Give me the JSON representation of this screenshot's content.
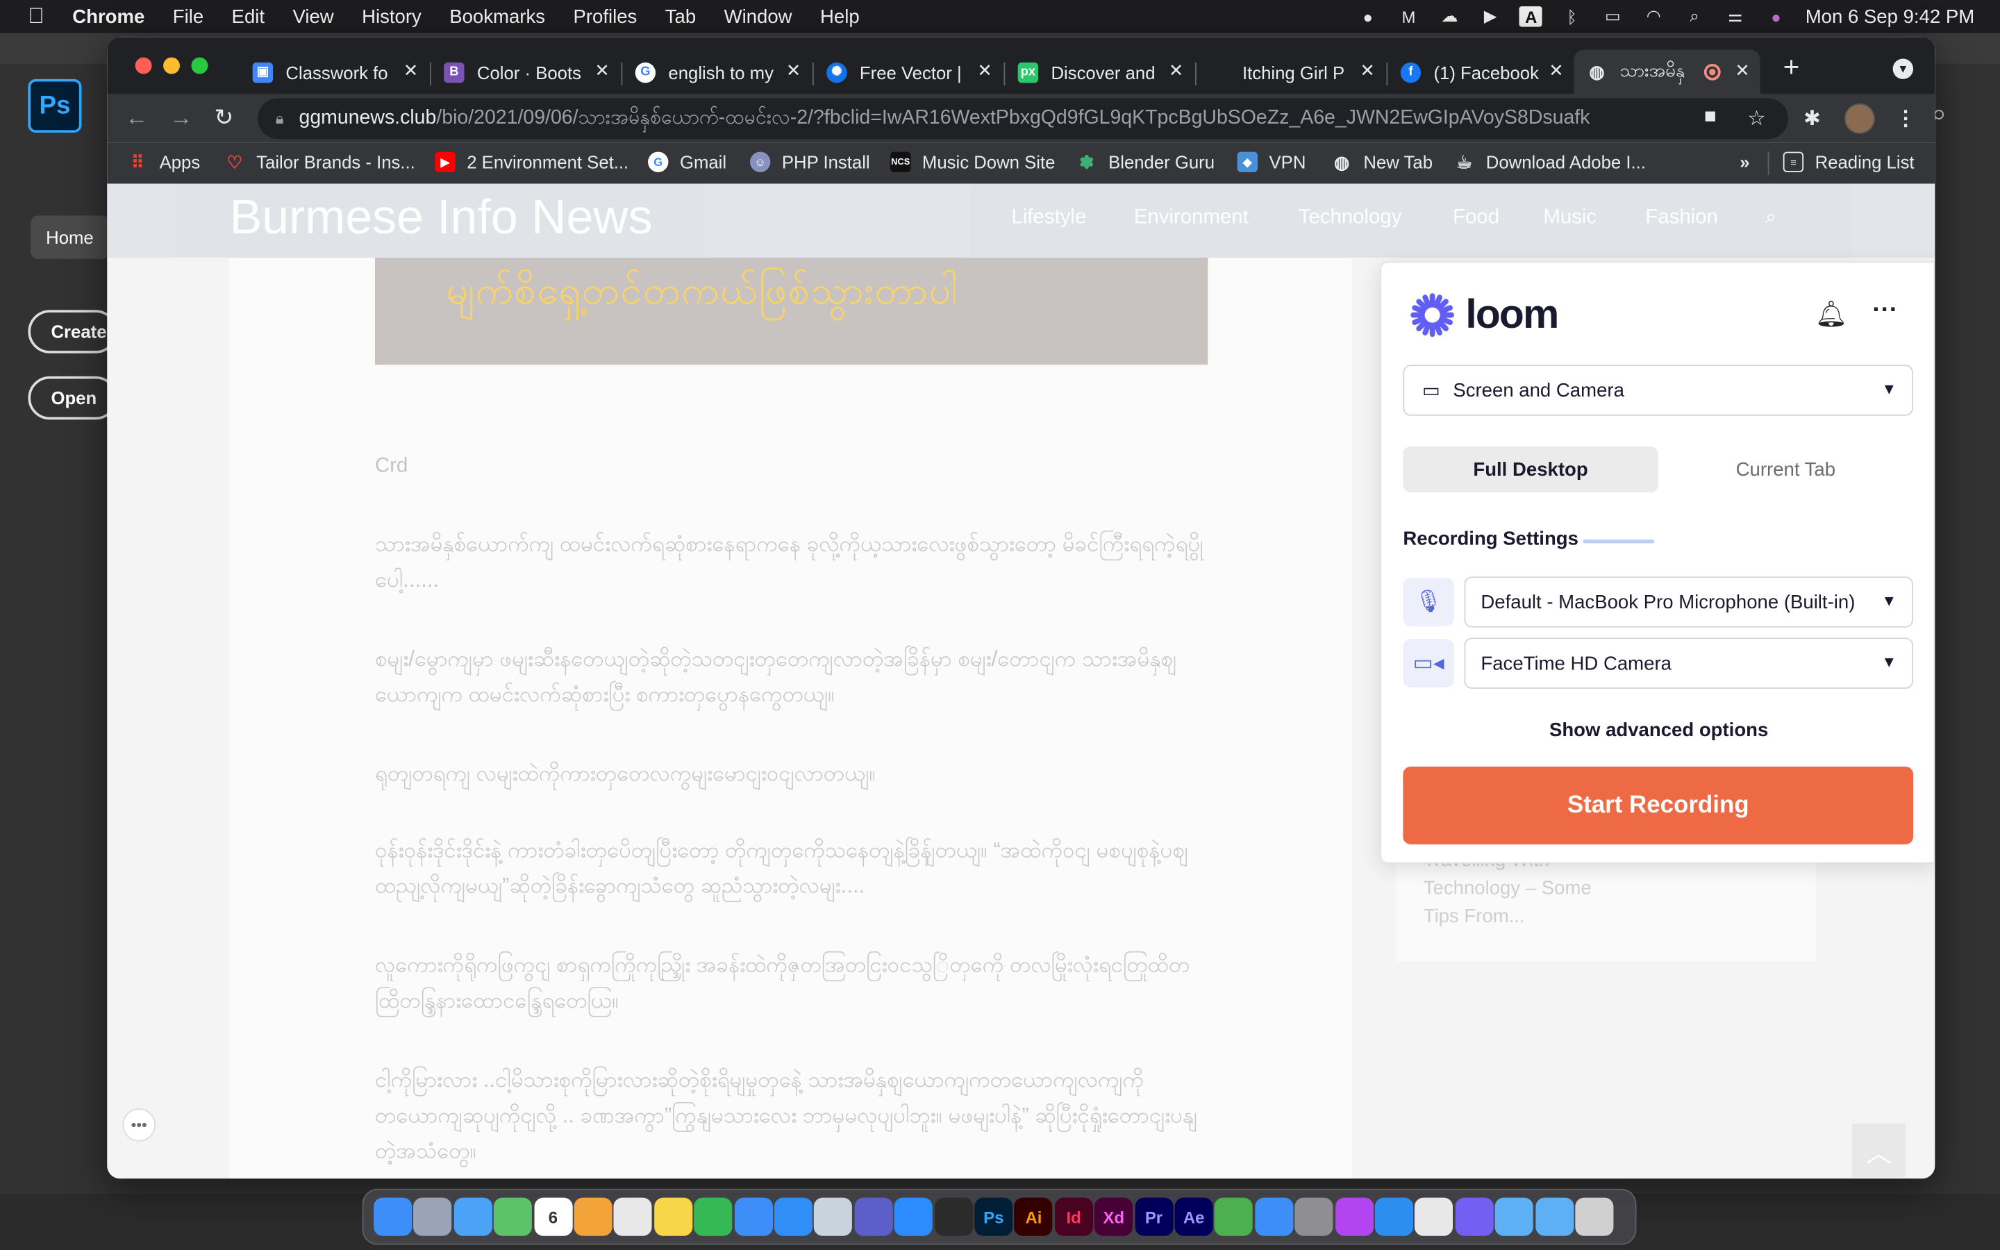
{
  "menubar": {
    "app": "Chrome",
    "menus": [
      "File",
      "Edit",
      "View",
      "History",
      "Bookmarks",
      "Profiles",
      "Tab",
      "Window",
      "Help"
    ],
    "datetime": "Mon 6 Sep  9:42 PM"
  },
  "photoshop": {
    "logo": "Ps",
    "home": "Home",
    "create": "Create",
    "open": "Open"
  },
  "tabs": [
    {
      "title": "Classwork fo",
      "icon": "classroom-icon",
      "color": "#4285f4"
    },
    {
      "title": "Color · Boots",
      "icon": "bootstrap-icon",
      "color": "#7952b3"
    },
    {
      "title": "english to my",
      "icon": "google-icon",
      "color": "#ffffff"
    },
    {
      "title": "Free Vector |",
      "icon": "freepik-icon",
      "color": "#1273eb"
    },
    {
      "title": "Discover and",
      "icon": "pixabay-icon",
      "color": "#2ec66d"
    },
    {
      "title": "Itching Girl P",
      "icon": "blank-icon",
      "color": "#202124"
    },
    {
      "title": "(1) Facebook",
      "icon": "facebook-icon",
      "color": "#1877f2"
    },
    {
      "title": "သားအမိနှ",
      "icon": "globe-icon",
      "color": "#9aa0a6"
    }
  ],
  "address": {
    "host": "ggmunews.club",
    "path": "/bio/2021/09/06/သားအမိနှစ်ယောက်-ထမင်းလ-2/?fbclid=IwAR16WextPbxgQd9fGL9qKTpcBgUbSOeZz_A6e_JWN2EwGIpAVoyS8Dsuafk"
  },
  "bookmarks": [
    {
      "label": "Apps",
      "icon": "apps-grid-icon",
      "color": "#ea4335"
    },
    {
      "label": "Tailor Brands - Ins...",
      "icon": "tailor-brands-icon",
      "color": "#e8453c"
    },
    {
      "label": "2 Environment Set...",
      "icon": "youtube-icon",
      "color": "#ff0000"
    },
    {
      "label": "Gmail",
      "icon": "google-icon",
      "color": "#ffffff"
    },
    {
      "label": "PHP Install",
      "icon": "php-install-icon",
      "color": "#8892bf"
    },
    {
      "label": "Music Down Site",
      "icon": "ncs-icon",
      "color": "#111111"
    },
    {
      "label": "Blender Guru",
      "icon": "blender-guru-icon",
      "color": "#3bb273"
    },
    {
      "label": "VPN",
      "icon": "vpn-icon",
      "color": "#4a90d9"
    },
    {
      "label": "New Tab",
      "icon": "globe-icon",
      "color": "#9aa0a6"
    },
    {
      "label": "Download Adobe I...",
      "icon": "adobe-icon",
      "color": "#aaaaaa"
    }
  ],
  "bookmarks_more": "»",
  "reading_list": "Reading List",
  "site": {
    "title": "Burmese Info News",
    "nav": [
      "Lifestyle",
      "Environment",
      "Technology",
      "Food",
      "Music",
      "Fashion"
    ],
    "hero_caption": "မျက်စိရှေ့တင်တကယ်ဖြစ်သွားတာပါ",
    "credit": "Crd",
    "paragraphs": [
      "သားအမိနှစ်ယောက်ကျ ထမင်းလက်ရဆုံစားနေရာကနေ ခုလို့ကိုယ့သားလေးဖွစ်သွားတော့ မိခင်ကြီးရရကဲ့ရပွိုပေါ့......",
      "စမျး/မွောကျမှာ ဖမျးဆီးနတေယျတဲ့ဆိုတဲ့သတငျးတှတေကျလာတဲ့အခြိန်မှာ စမျး/တောငျက သားအမိနှစျယောကျက ထမင်းလက်ဆုံစားပြီး စကားတှပွောနကွေတယျ။",
      "ရုတျတရကျ လမျးထဲကိုကားတှတေလကွမျးမောငျးဝငျလာတယျ။",
      "ဝုန်းဝုန်းဒိုင်းဒိုင်းနဲ့ ကားတံခါးတှပေိတျပြီးတော့ တိုကျတှကေိုသနေတျနဲ့ခြိန်ျတယျ။ “အထဲကိုဝငျ မစပျစုနဲ့ပစျထညျ့လိုကျမယျ”ဆိုတဲ့ခြိန်းခွောကျသံတွေ ဆူညံသွားတဲ့လမျး....",
      "လူကေားကိုရိုကဖြကွငျ စာရှကကြိုကုည္ဒြိုး အခန်းထဲကိုဇှတအြတငြးဝငသွြိတှကေို တလမြိုးလုံးရငတြုထိတထြိတန္ဒြနားထောငန္ဒြေရတေယြ။",
      "ငါ့ကိုမြားလား ..ငါ့မိသားစုကိုမြားလားဆိုတဲ့စိုးရိမျမှုတှနေဲ့ သားအမိနှစျယောကျကတယောကျလကျကို တယောကျဆုပျကိုငျလို့ .. ခဏအကွာ”ကြွနျမသားလေး ဘာမှမလုပျပါဘူး။ မဖမျးပါနဲ့” ဆိုပြီးငိုရှုံးတောငျးပနျတဲ့အသံတွေ။"
    ],
    "sidebar_text": "Travelling With Technology – Some Tips From..."
  },
  "loom": {
    "brand": "loom",
    "capture_mode": "Screen and Camera",
    "segments": [
      "Full Desktop",
      "Current Tab"
    ],
    "active_segment": "Full Desktop",
    "settings_label": "Recording Settings",
    "microphone": "Default - MacBook Pro Microphone (Built-in)",
    "camera": "FaceTime HD Camera",
    "advanced": "Show advanced options",
    "start": "Start Recording",
    "accent": "#ed6a45"
  },
  "dock": [
    {
      "name": "finder-icon",
      "color": "#3d8ef7",
      "label": ""
    },
    {
      "name": "launchpad-icon",
      "color": "#9aa4b8",
      "label": ""
    },
    {
      "name": "mail-icon",
      "color": "#4aa3f7",
      "label": ""
    },
    {
      "name": "maps-icon",
      "color": "#5cc36b",
      "label": ""
    },
    {
      "name": "calendar-icon",
      "color": "#ffffff",
      "label": "6"
    },
    {
      "name": "pages-icon",
      "color": "#f2a33a",
      "label": ""
    },
    {
      "name": "textedit-icon",
      "color": "#e8e8e8",
      "label": ""
    },
    {
      "name": "notes-icon",
      "color": "#f7d64a",
      "label": ""
    },
    {
      "name": "numbers-icon",
      "color": "#34b955",
      "label": ""
    },
    {
      "name": "keynote-icon",
      "color": "#3d8ef7",
      "label": ""
    },
    {
      "name": "app-store-icon",
      "color": "#2f8ff7",
      "label": ""
    },
    {
      "name": "preview-icon",
      "color": "#c9d3de",
      "label": ""
    },
    {
      "name": "teams-icon",
      "color": "#5b5fc7",
      "label": ""
    },
    {
      "name": "zoom-icon",
      "color": "#2d8cff",
      "label": ""
    },
    {
      "name": "blender-icon",
      "color": "#2b2b2b",
      "label": ""
    },
    {
      "name": "photoshop-icon",
      "color": "#001e36",
      "label": "Ps"
    },
    {
      "name": "illustrator-icon",
      "color": "#330000",
      "label": "Ai"
    },
    {
      "name": "indesign-icon",
      "color": "#49021f",
      "label": "Id"
    },
    {
      "name": "xd-icon",
      "color": "#470137",
      "label": "Xd"
    },
    {
      "name": "premiere-icon",
      "color": "#00005b",
      "label": "Pr"
    },
    {
      "name": "after-effects-icon",
      "color": "#00005b",
      "label": "Ae"
    },
    {
      "name": "chrome-icon",
      "color": "#4caf50",
      "label": ""
    },
    {
      "name": "safari-icon",
      "color": "#3d8ef7",
      "label": ""
    },
    {
      "name": "system-preferences-icon",
      "color": "#8e8e93",
      "label": ""
    },
    {
      "name": "phpstorm-icon",
      "color": "#b345f1",
      "label": ""
    },
    {
      "name": "vscode-icon",
      "color": "#2c8ff0",
      "label": ""
    },
    {
      "name": "tableplus-icon",
      "color": "#e8e8e8",
      "label": ""
    },
    {
      "name": "viber-icon",
      "color": "#7360f2",
      "label": ""
    },
    {
      "name": "downloads-folder-icon",
      "color": "#5eb0f5",
      "label": ""
    },
    {
      "name": "folder-icon",
      "color": "#5eb0f5",
      "label": ""
    },
    {
      "name": "trash-icon",
      "color": "#d0d0d0",
      "label": ""
    }
  ]
}
